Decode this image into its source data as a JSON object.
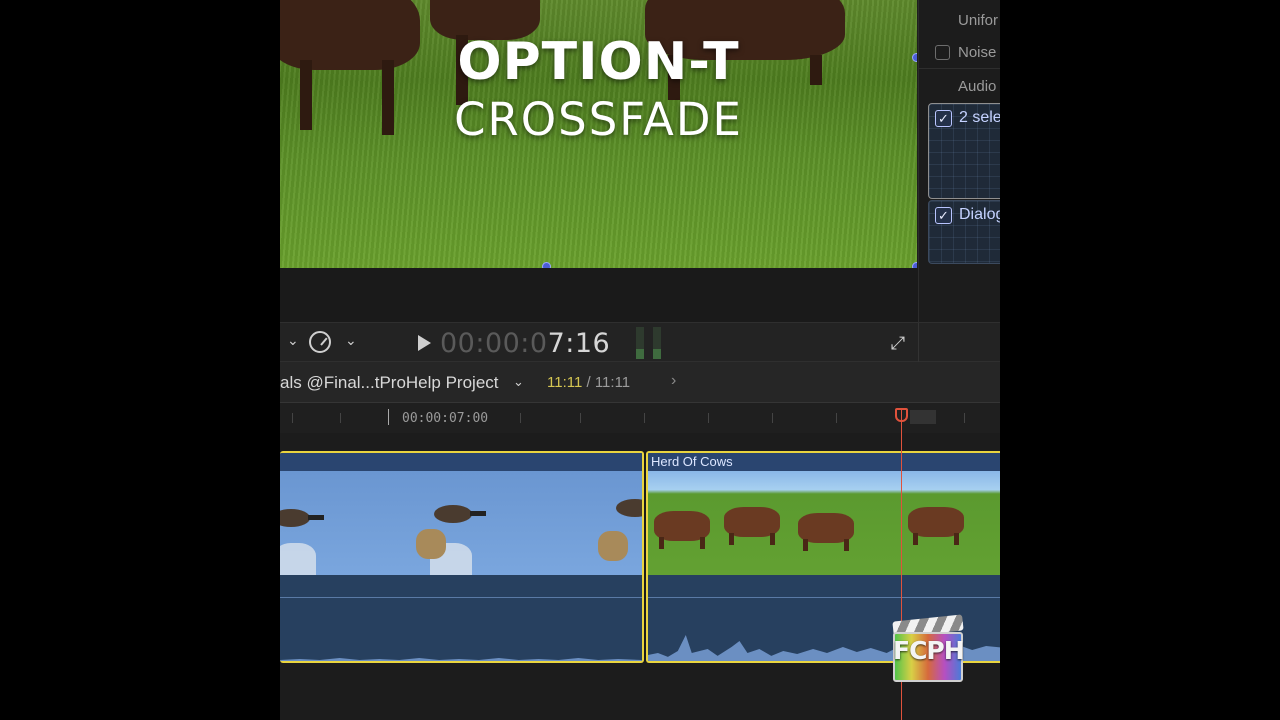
{
  "viewer": {
    "title_line1": "OPTION-T",
    "title_line2": "CROSSFADE"
  },
  "inspector": {
    "row1_label": "Unifor",
    "row2_label": "Noise",
    "section_label": "Audio",
    "role1_label": "2 sele",
    "role2_label": "Dialog",
    "role_checkmark": "✓"
  },
  "transport": {
    "speed_chevron": "⌄",
    "view_chevron": "⌄",
    "timecode_dim": "00:00:0",
    "timecode_bright": "7:16",
    "fullscreen_glyph": "⤢"
  },
  "timeline": {
    "project_name": "als @Final...tProHelp Project",
    "project_chevron": "⌄",
    "duration_current": "11:11",
    "duration_separator": " / ",
    "duration_total": "11:11",
    "forward_chevron": "›",
    "ruler_label": "00:00:07:00",
    "clips": [
      {
        "name": ""
      },
      {
        "name": "Herd Of Cows"
      }
    ]
  },
  "logo": {
    "text": "FCPH"
  },
  "colors": {
    "selection": "#e9d43f",
    "playhead": "#e0523c",
    "clip_blue": "#1e3557",
    "duration_accent": "#d4c552"
  }
}
